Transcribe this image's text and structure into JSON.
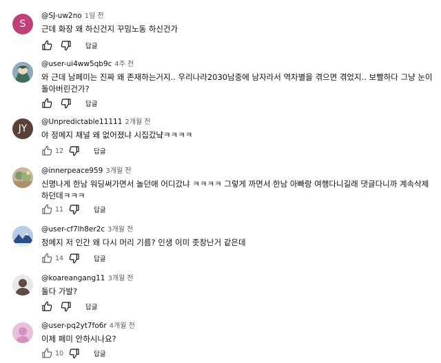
{
  "comments": [
    {
      "handle": "@SJ-uw2no",
      "time": "1일 전",
      "text": "근데 화장 왜 하신건지 꾸밈노동 하신건가",
      "likes": "",
      "avatar_letter": "S",
      "avatar_color": "#c0417a",
      "reply_label": "답글"
    },
    {
      "handle": "@user-ui4ww5qb9c",
      "time": "4주 전",
      "text": "와 근데 남페미는 진짜 왜 존재하는거지.. 우리나라2030남중에 남자라서 역차별을 겪으면 겪었지.. 보빨하다 그냥 눈이 돌아버린건가?",
      "likes": "",
      "avatar_icon": "anime-avatar",
      "reply_label": "답글"
    },
    {
      "handle": "@Unpredictable11111",
      "time": "2개월 전",
      "text": "야 정메지 채널 왜 없어졌냐 시집갔냨ㅋㅋㅋㅋ",
      "likes": "12",
      "avatar_letter": "JY",
      "avatar_color": "#5b4037",
      "reply_label": "답글"
    },
    {
      "handle": "@innerpeace959",
      "time": "3개월 전",
      "text": "신명나게 한남 워딩써가면서 놀던애 어디갔냐 ㅋㅋㅋㅋ 그렇게 까면서 한남 아빠랑 여행다니길래 댓글다니까 계속삭제하던데ㅋㅋㅋ",
      "likes": "11",
      "avatar_icon": "landscape-avatar",
      "reply_label": "답글"
    },
    {
      "handle": "@user-cf7lh8er2c",
      "time": "3개월 전",
      "text": "정메지 저 인간 왜 다시 머리 기름? 인생 이미 좃창난거 같은데",
      "likes": "14",
      "avatar_icon": "mountain-avatar",
      "reply_label": "답글"
    },
    {
      "handle": "@koareangang11",
      "time": "3개월 전",
      "text": "둘다 가발?",
      "likes": "",
      "avatar_icon": "default-person-avatar",
      "reply_label": "답글"
    },
    {
      "handle": "@user-pq2yt7fo6r",
      "time": "4개월 전",
      "text": "이제 페미 안하시나요?",
      "likes": "10",
      "avatar_icon": "pink-avatar",
      "reply_label": "답글"
    }
  ]
}
